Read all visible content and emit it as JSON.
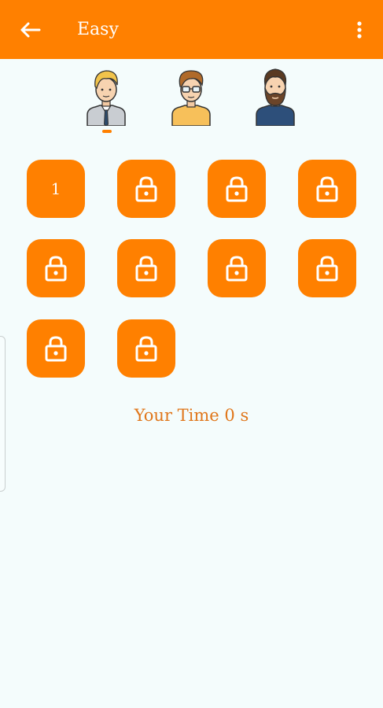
{
  "app_bar": {
    "title": "Easy",
    "back_icon": "arrow-left-icon",
    "menu_icon": "more-vert-icon",
    "color": "#ff8000"
  },
  "avatars": [
    {
      "name": "avatar-blond-man",
      "icon": "avatar-icon"
    },
    {
      "name": "avatar-glasses-man",
      "icon": "avatar-icon"
    },
    {
      "name": "avatar-bearded-man",
      "icon": "avatar-icon"
    }
  ],
  "selected_avatar_index": 0,
  "levels": [
    {
      "label": "1",
      "locked": false
    },
    {
      "label": "",
      "locked": true
    },
    {
      "label": "",
      "locked": true
    },
    {
      "label": "",
      "locked": true
    },
    {
      "label": "",
      "locked": true
    },
    {
      "label": "",
      "locked": true
    },
    {
      "label": "",
      "locked": true
    },
    {
      "label": "",
      "locked": true
    },
    {
      "label": "",
      "locked": true
    },
    {
      "label": "",
      "locked": true
    }
  ],
  "timer": {
    "text": "Your Time 0 s"
  }
}
